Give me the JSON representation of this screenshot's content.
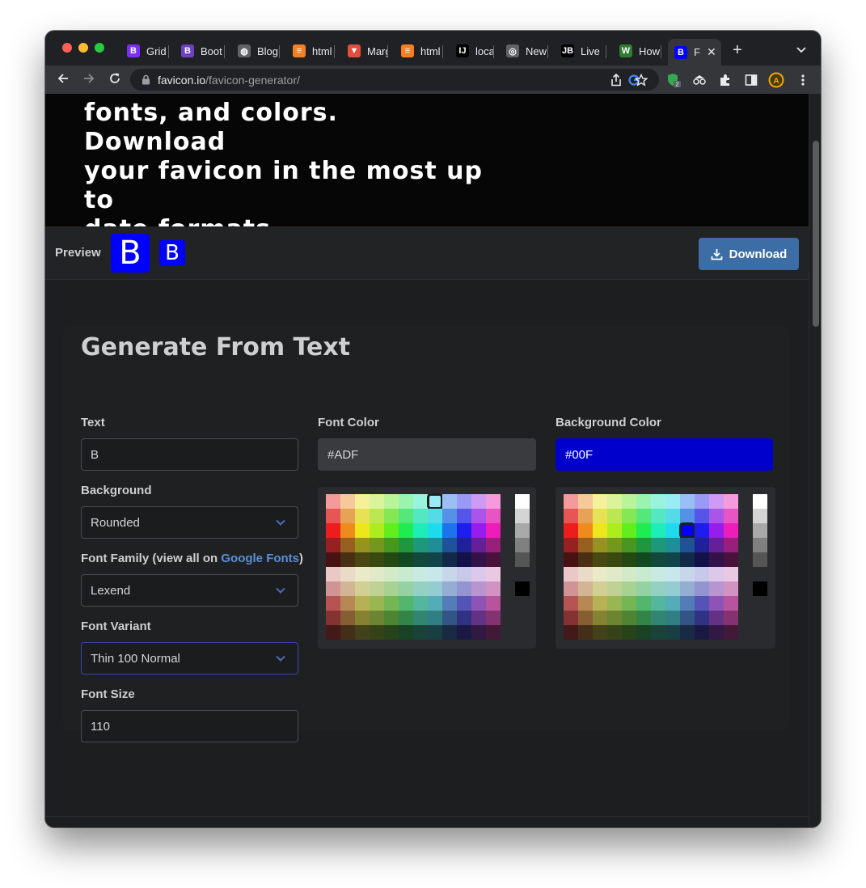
{
  "browser": {
    "tabs": [
      {
        "label": "Grid",
        "icon": "bootstrap-icon",
        "color": "#7b2ff7",
        "glyph": "B"
      },
      {
        "label": "Boot",
        "icon": "bootstrap-icon",
        "color": "#6f42c1",
        "glyph": "B"
      },
      {
        "label": "Blog",
        "icon": "globe-icon",
        "color": "#5f6368",
        "glyph": "◍"
      },
      {
        "label": "html",
        "icon": "stackoverflow-icon",
        "color": "#f48024",
        "glyph": "≡"
      },
      {
        "label": "Marg",
        "icon": "tuts-icon",
        "color": "#e44d3a",
        "glyph": "▼"
      },
      {
        "label": "html",
        "icon": "stackoverflow-icon",
        "color": "#f48024",
        "glyph": "≡"
      },
      {
        "label": "local",
        "icon": "intellij-icon",
        "color": "#000000",
        "glyph": "IJ"
      },
      {
        "label": "New",
        "icon": "chrome-icon",
        "color": "#5f6368",
        "glyph": "◎"
      },
      {
        "label": "Live",
        "icon": "jetbrains-icon",
        "color": "#000000",
        "glyph": "JB"
      },
      {
        "label": "How",
        "icon": "w-icon",
        "color": "#2e7d32",
        "glyph": "W"
      },
      {
        "label": "F",
        "icon": "bootstrap-icon",
        "color": "#0000ff",
        "glyph": "B",
        "active": true
      }
    ],
    "url_host": "favicon.io",
    "url_path": "/favicon-generator/",
    "extension_badge": "2"
  },
  "hero": {
    "lines": [
      "fonts, and colors. Download",
      "your favicon in the most up to",
      "date formats."
    ]
  },
  "preview": {
    "label": "Preview",
    "letter": "B",
    "download_label": "Download"
  },
  "form": {
    "title": "Generate From Text",
    "text_label": "Text",
    "text_value": "B",
    "background_label": "Background",
    "background_value": "Rounded",
    "font_family_label_prefix": "Font Family (view all on ",
    "font_family_link": "Google Fonts",
    "font_family_label_suffix": ")",
    "font_family_value": "Lexend",
    "font_variant_label": "Font Variant",
    "font_variant_value": "Thin 100 Normal",
    "font_size_label": "Font Size",
    "font_size_value": "110",
    "font_color_label": "Font Color",
    "font_color_value": "#ADF",
    "bg_color_label": "Background Color",
    "bg_color_value": "#00F"
  },
  "colors": {
    "bg_swatch": "#0000ff",
    "accent": "#3c6da4"
  }
}
